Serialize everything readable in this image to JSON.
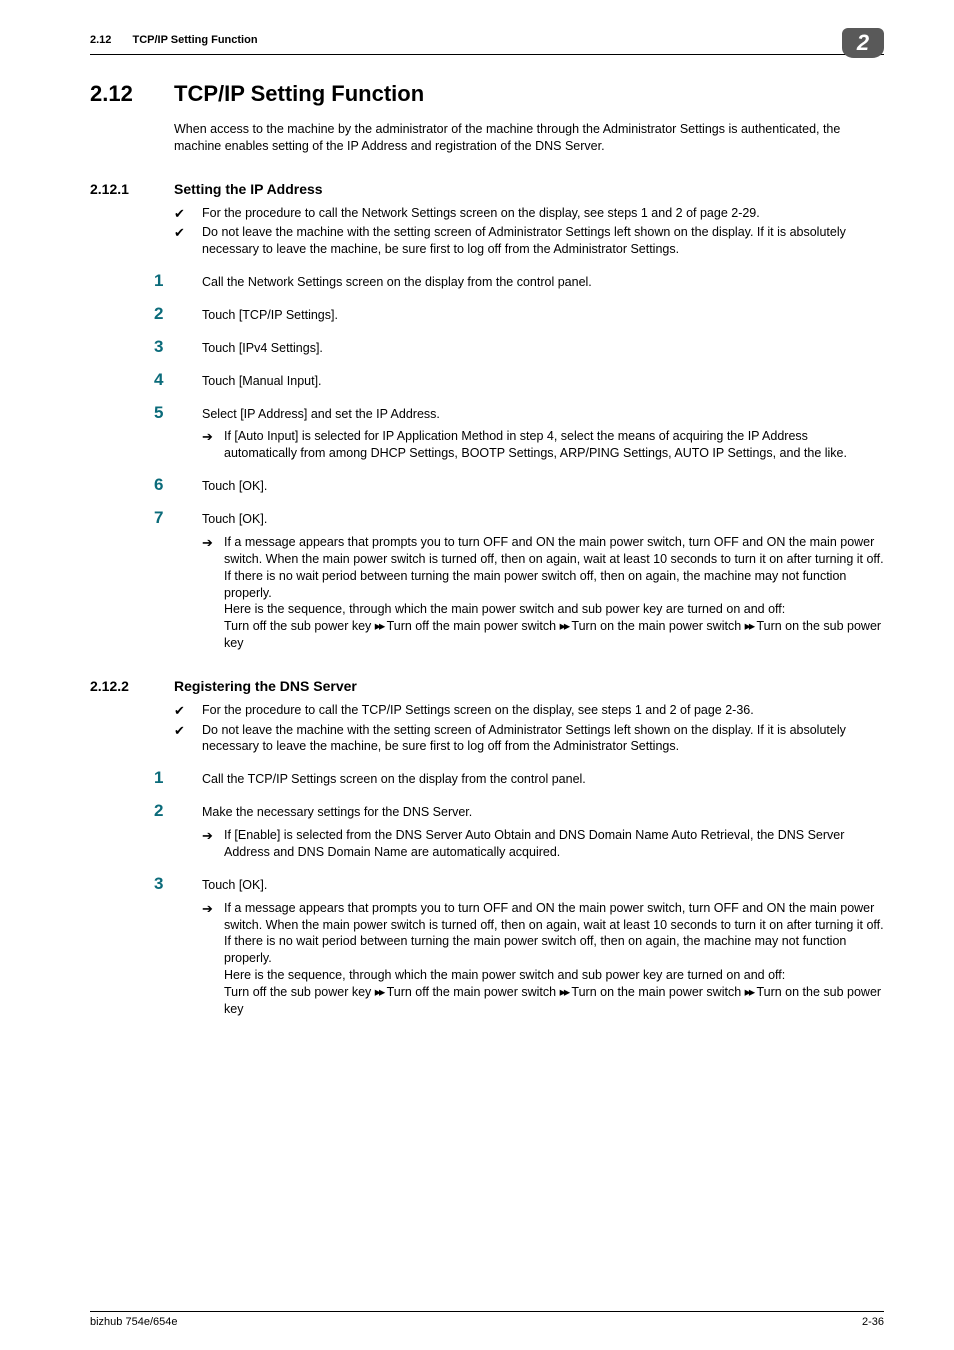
{
  "header": {
    "section_number": "2.12",
    "section_title": "TCP/IP Setting Function",
    "chapter_number": "2"
  },
  "h1": {
    "number": "2.12",
    "title": "TCP/IP Setting Function",
    "intro": "When access to the machine by the administrator of the machine through the Administrator Settings is authenticated, the machine enables setting of the IP Address and registration of the DNS Server."
  },
  "s1": {
    "number": "2.12.1",
    "title": "Setting the IP Address",
    "bullets": [
      "For the procedure to call the Network Settings screen on the display, see steps 1 and 2 of page 2-29.",
      "Do not leave the machine with the setting screen of Administrator Settings left shown on the display. If it is absolutely necessary to leave the machine, be sure first to log off from the Administrator Settings."
    ],
    "steps": {
      "1": "Call the Network Settings screen on the display from the control panel.",
      "2": "Touch [TCP/IP Settings].",
      "3": "Touch [IPv4 Settings].",
      "4": "Touch [Manual Input].",
      "5": "Select [IP Address] and set the IP Address.",
      "5_sub": "If [Auto Input] is selected for IP Application Method in step 4, select the means of acquiring the IP Address automatically from among DHCP Settings, BOOTP Settings, ARP/PING Settings, AUTO IP Settings, and the like.",
      "6": "Touch [OK].",
      "7": "Touch [OK].",
      "7_sub_a": "If a message appears that prompts you to turn OFF and ON the main power switch, turn OFF and ON the main power switch. When the main power switch is turned off, then on again, wait at least 10 seconds to turn it on after turning it off. If there is no wait period between turning the main power switch off, then on again, the machine may not function properly.",
      "7_sub_b": "Here is the sequence, through which the main power switch and sub power key are turned on and off:",
      "7_sub_c_1": "Turn off the sub power key ",
      "7_sub_c_2": " Turn off the main power switch ",
      "7_sub_c_3": " Turn on the main power switch ",
      "7_sub_c_4": " Turn on the sub power key"
    }
  },
  "s2": {
    "number": "2.12.2",
    "title": "Registering the DNS Server",
    "bullets": [
      "For the procedure to call the TCP/IP Settings screen on the display, see steps 1 and 2 of page 2-36.",
      "Do not leave the machine with the setting screen of Administrator Settings left shown on the display. If it is absolutely necessary to leave the machine, be sure first to log off from the Administrator Settings."
    ],
    "steps": {
      "1": "Call the TCP/IP Settings screen on the display from the control panel.",
      "2": "Make the necessary settings for the DNS Server.",
      "2_sub": "If [Enable] is selected from the DNS Server Auto Obtain and DNS Domain Name Auto Retrieval, the DNS Server Address and DNS Domain Name are automatically acquired.",
      "3": "Touch [OK].",
      "3_sub_a": "If a message appears that prompts you to turn OFF and ON the main power switch, turn OFF and ON the main power switch. When the main power switch is turned off, then on again, wait at least 10 seconds to turn it on after turning it off. If there is no wait period between turning the main power switch off, then on again, the machine may not function properly.",
      "3_sub_b": "Here is the sequence, through which the main power switch and sub power key are turned on and off:",
      "3_sub_c_1": "Turn off the sub power key ",
      "3_sub_c_2": " Turn off the main power switch ",
      "3_sub_c_3": " Turn on the main power switch ",
      "3_sub_c_4": " Turn on the sub power key"
    }
  },
  "footer": {
    "model": "bizhub 754e/654e",
    "page": "2-36"
  },
  "glyphs": {
    "check": "✔",
    "arrow": "➔",
    "dbl": "▸▸"
  }
}
